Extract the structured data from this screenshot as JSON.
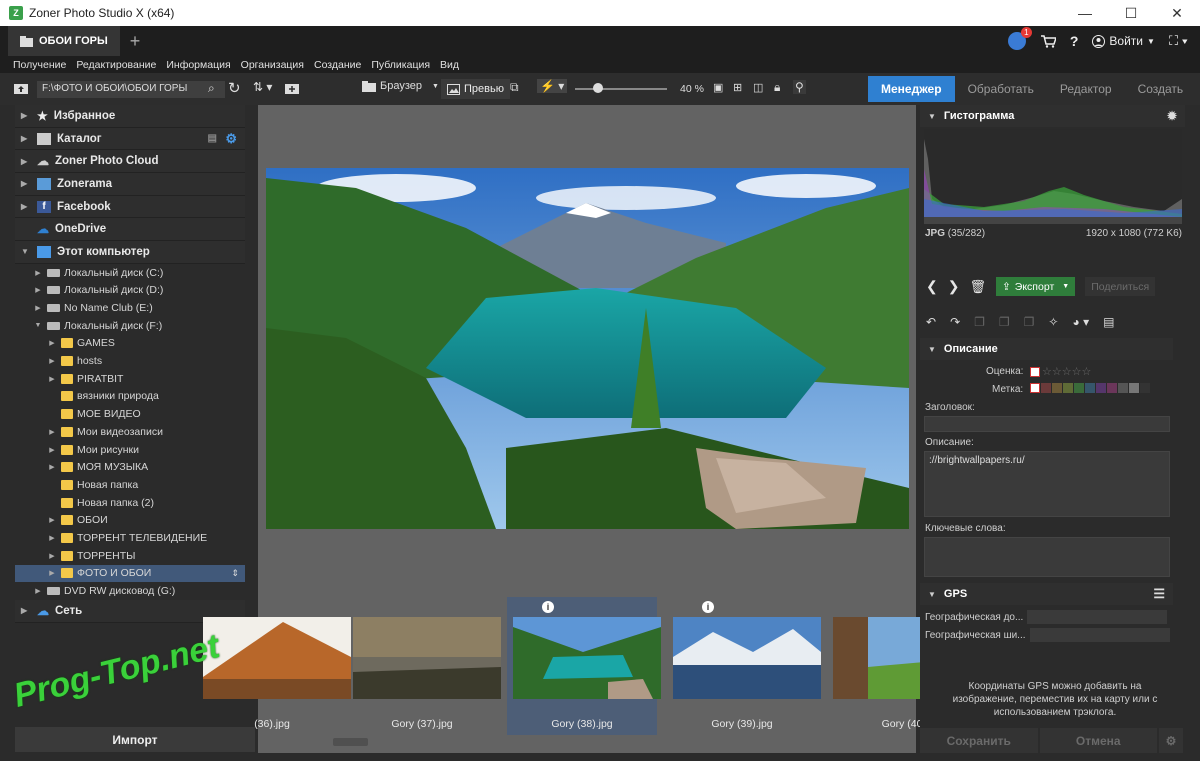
{
  "window": {
    "title": "Zoner Photo Studio X (x64)",
    "minimize": "—",
    "maximize": "☐",
    "close": "✕"
  },
  "tabbar": {
    "doc_tab": "ОБОИ ГОРЫ",
    "add_tab": "+",
    "notification_count": "1",
    "login": "Войти"
  },
  "menu": [
    "Получение",
    "Редактирование",
    "Информация",
    "Организация",
    "Создание",
    "Публикация",
    "Вид"
  ],
  "toolbar": {
    "path": "F:\\ФОТО И ОБОИ\\ОБОИ ГОРЫ",
    "browser": "Браузер",
    "preview": "Превью",
    "zoom": "40 %",
    "zoom_fraction": 0.25
  },
  "modes": [
    "Менеджер",
    "Обработать",
    "Редактор",
    "Создать"
  ],
  "nav_top": [
    {
      "label": "Избранное",
      "icon": "star-icon"
    },
    {
      "label": "Каталог",
      "icon": "catalog-icon"
    },
    {
      "label": "Zoner Photo Cloud",
      "icon": "cloud-icon"
    },
    {
      "label": "Zonerama",
      "icon": "zonerama-icon"
    },
    {
      "label": "Facebook",
      "icon": "facebook-icon"
    },
    {
      "label": "OneDrive",
      "icon": "onedrive-icon"
    },
    {
      "label": "Этот компьютер",
      "icon": "computer-icon"
    }
  ],
  "drives": [
    "Локальный диск (C:)",
    "Локальный диск (D:)",
    "No Name Club (E:)",
    "Локальный диск (F:)"
  ],
  "folders": [
    "GAMES",
    "hosts",
    "PIRATBIT",
    "вязники природа",
    "МОЕ ВИДЕО",
    "Мои видеозаписи",
    "Мои рисунки",
    "МОЯ МУЗЫКА",
    "Новая папка",
    "Новая папка (2)",
    "ОБОИ",
    "ТОРРЕНТ ТЕЛЕВИДЕНИЕ",
    "ТОРРЕНТЫ",
    "ФОТО И ОБОИ"
  ],
  "dvd": "DVD RW дисковод (G:)",
  "network": "Сеть",
  "import": "Импорт",
  "filmstrip": [
    {
      "label": "(36).jpg"
    },
    {
      "label": "Gory (37).jpg"
    },
    {
      "label": "Gory (38).jpg"
    },
    {
      "label": "Gory (39).jpg"
    },
    {
      "label": "Gory (40"
    }
  ],
  "histogram": {
    "title": "Гистограмма",
    "format": "JPG",
    "index": "(35/282)",
    "dimensions": "1920 x 1080 (772 K6)"
  },
  "actions": {
    "export": "Экспорт",
    "share": "Поделиться"
  },
  "description": {
    "title": "Описание",
    "rating_label": "Оценка:",
    "label_label": "Метка:",
    "heading_label": "Заголовок:",
    "desc_label": "Описание:",
    "desc_value": "://brightwallpapers.ru/",
    "keywords_label": "Ключевые слова:"
  },
  "gps": {
    "title": "GPS",
    "lon_label": "Географическая до...",
    "lat_label": "Географическая ши...",
    "note": "Координаты GPS можно добавить на изображение, переместив их на карту или с использованием трэклога."
  },
  "buttons": {
    "save": "Сохранить",
    "cancel": "Отмена"
  },
  "watermark": "Prog-Top.net",
  "colors": {
    "accent": "#2f80d1",
    "export": "#2f7d3b",
    "selection": "#41597a"
  }
}
